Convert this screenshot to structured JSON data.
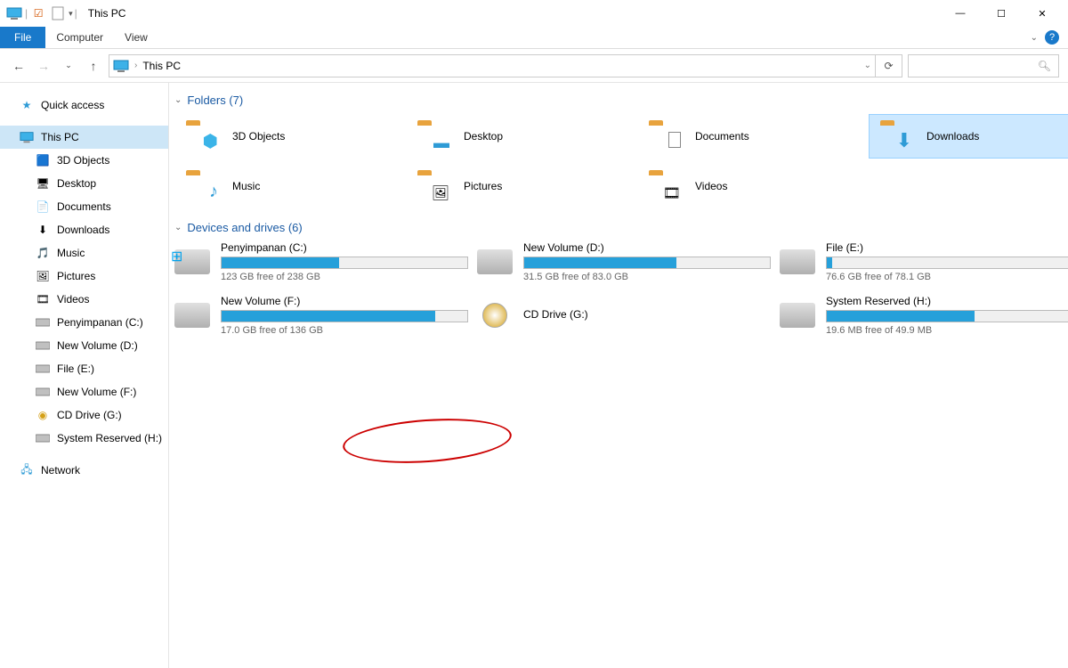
{
  "window": {
    "title": "This PC",
    "buttons": {
      "min": "—",
      "max": "☐",
      "close": "✕"
    }
  },
  "ribbon": {
    "file": "File",
    "tabs": [
      "Computer",
      "View"
    ]
  },
  "address": {
    "path": "This PC",
    "sep": "›"
  },
  "sidebar": {
    "quick": "Quick access",
    "thispc": "This PC",
    "items": [
      "3D Objects",
      "Desktop",
      "Documents",
      "Downloads",
      "Music",
      "Pictures",
      "Videos",
      "Penyimpanan (C:)",
      "New Volume (D:)",
      "File (E:)",
      "New Volume (F:)",
      "CD Drive (G:)",
      "System Reserved (H:)"
    ],
    "network": "Network"
  },
  "sections": {
    "folders_label": "Folders (7)",
    "drives_label": "Devices and drives (6)"
  },
  "folders": [
    {
      "name": "3D Objects",
      "overlay": "cube",
      "sel": false
    },
    {
      "name": "Desktop",
      "overlay": "screen",
      "sel": false
    },
    {
      "name": "Documents",
      "overlay": "doc",
      "sel": false
    },
    {
      "name": "Downloads",
      "overlay": "down",
      "sel": true
    },
    {
      "name": "Music",
      "overlay": "note",
      "sel": false
    },
    {
      "name": "Pictures",
      "overlay": "photo",
      "sel": false
    },
    {
      "name": "Videos",
      "overlay": "film",
      "sel": false
    }
  ],
  "drives": [
    {
      "name": "Penyimpanan (C:)",
      "stat": "123 GB free of 238 GB",
      "fill": 48,
      "win": true
    },
    {
      "name": "New Volume (D:)",
      "stat": "31.5 GB free of 83.0 GB",
      "fill": 62,
      "win": false
    },
    {
      "name": "File (E:)",
      "stat": "76.6 GB free of 78.1 GB",
      "fill": 2,
      "win": false
    },
    {
      "name": "New Volume (F:)",
      "stat": "17.0 GB free of 136 GB",
      "fill": 87,
      "win": false
    },
    {
      "name": "CD Drive (G:)",
      "stat": "",
      "fill": -1,
      "win": false
    },
    {
      "name": "System Reserved (H:)",
      "stat": "19.6 MB free of 49.9 MB",
      "fill": 60,
      "win": false
    }
  ]
}
